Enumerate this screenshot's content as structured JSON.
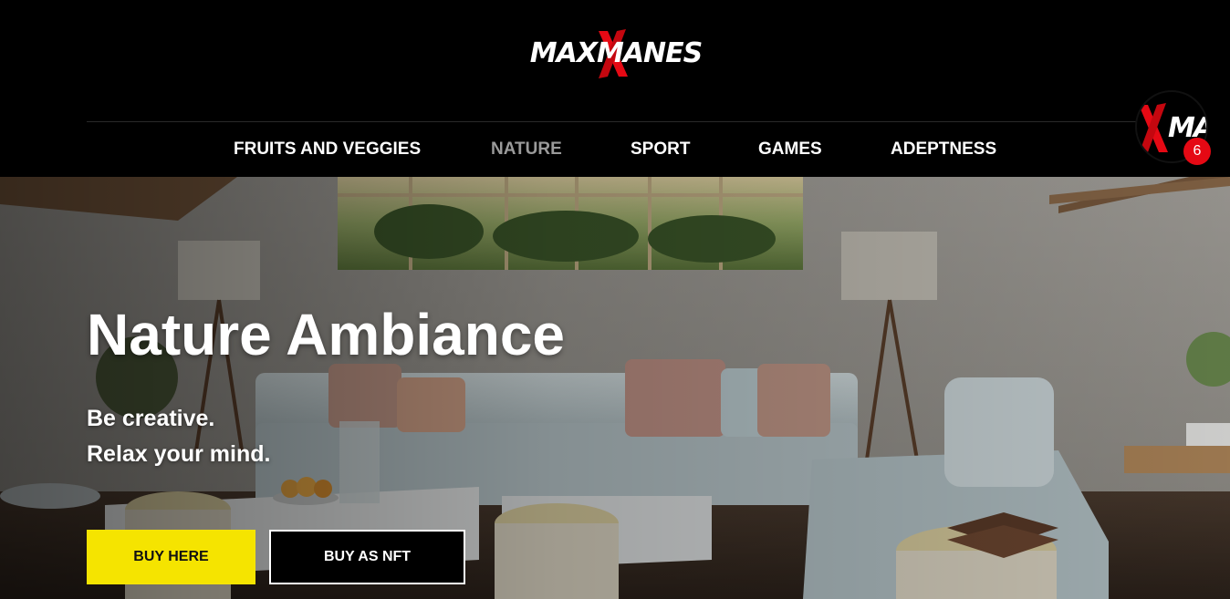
{
  "header": {
    "logo_text": "MAXMANES"
  },
  "nav": {
    "items": [
      {
        "label": "FRUITS AND VEGGIES",
        "active": false
      },
      {
        "label": "NATURE",
        "active": true
      },
      {
        "label": "SPORT",
        "active": false
      },
      {
        "label": "GAMES",
        "active": false
      },
      {
        "label": "ADEPTNESS",
        "active": false
      }
    ]
  },
  "cart": {
    "avatar_text": "MAN",
    "count": "6"
  },
  "hero": {
    "title": "Nature Ambiance",
    "subtitle_line1": "Be creative.",
    "subtitle_line2": "Relax your mind.",
    "primary_button": "BUY HERE",
    "secondary_button": "BUY AS NFT"
  },
  "colors": {
    "background": "#000000",
    "accent_yellow": "#f5e400",
    "brand_red": "#e50914",
    "nav_active": "#9a9a9a"
  }
}
